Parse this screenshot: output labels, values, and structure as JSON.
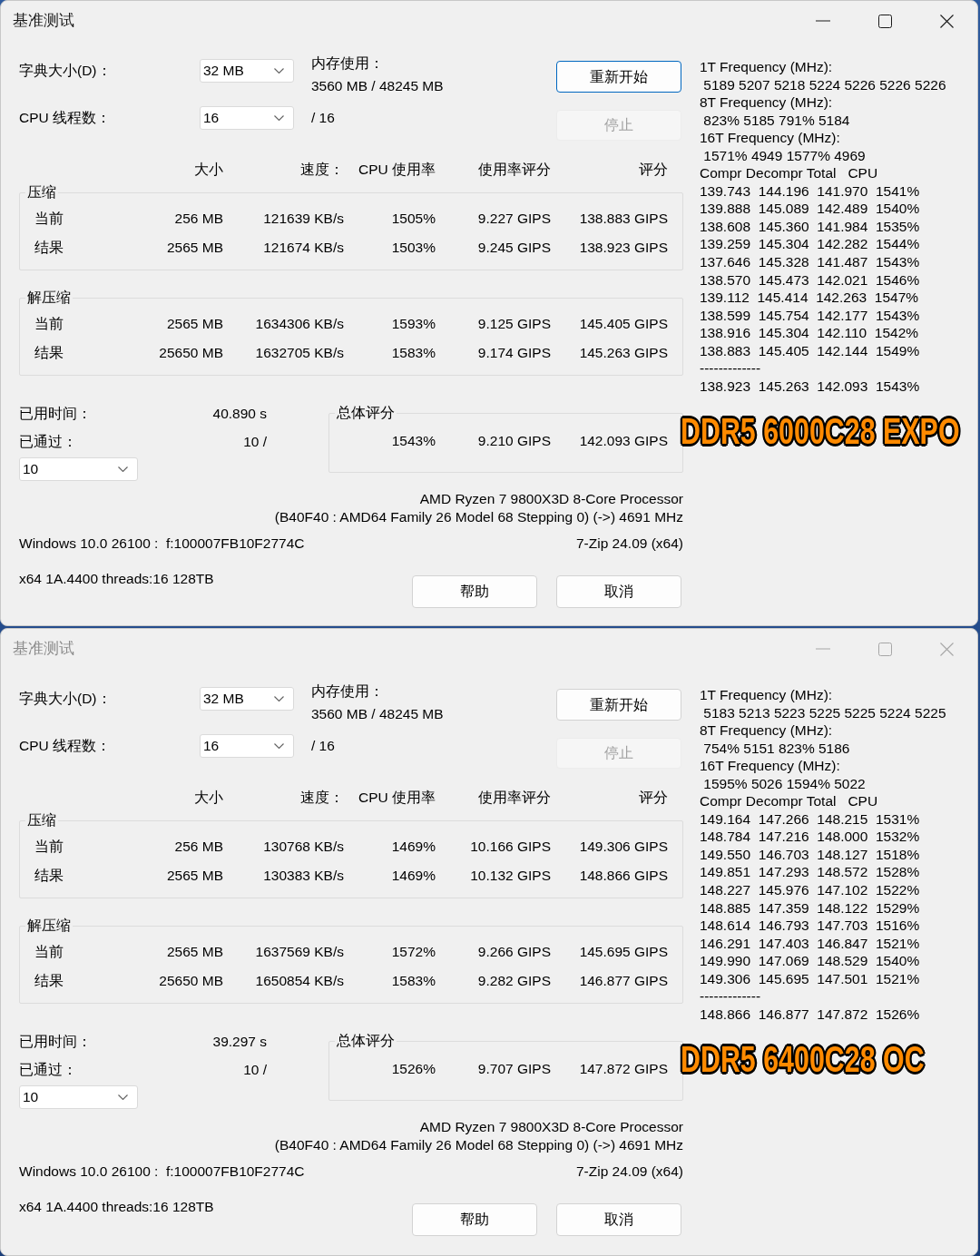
{
  "windows": [
    {
      "title": "基准测试",
      "active": true,
      "dictionary": {
        "label": "字典大小(D)：",
        "value": "32 MB"
      },
      "memory": {
        "label": "内存使用：",
        "value": "3560 MB / 48245 MB"
      },
      "threads": {
        "label": "CPU 线程数：",
        "value": "16",
        "total": "/ 16"
      },
      "action_buttons": [
        {
          "label": "重新开始",
          "focused": true,
          "disabled": false
        },
        {
          "label": "停止",
          "focused": false,
          "disabled": true
        }
      ],
      "columns": [
        "大小",
        "速度：",
        "CPU 使用率",
        "使用率评分",
        "评分"
      ],
      "groups": [
        {
          "title": "压缩",
          "rows": [
            {
              "label": "当前",
              "cells": [
                "256 MB",
                "121639 KB/s",
                "1505%",
                "9.227 GIPS",
                "138.883 GIPS"
              ]
            },
            {
              "label": "结果",
              "cells": [
                "2565 MB",
                "121674 KB/s",
                "1503%",
                "9.245 GIPS",
                "138.923 GIPS"
              ]
            }
          ]
        },
        {
          "title": "解压缩",
          "rows": [
            {
              "label": "当前",
              "cells": [
                "2565 MB",
                "1634306 KB/s",
                "1593%",
                "9.125 GIPS",
                "145.405 GIPS"
              ]
            },
            {
              "label": "结果",
              "cells": [
                "25650 MB",
                "1632705 KB/s",
                "1583%",
                "9.174 GIPS",
                "145.263 GIPS"
              ]
            }
          ]
        }
      ],
      "elapsed": {
        "label": "已用时间：",
        "value": "40.890 s"
      },
      "passes": {
        "label": "已通过：",
        "value": "10 /",
        "dropdown": "10"
      },
      "total": {
        "title": "总体评分",
        "cells": [
          "1543%",
          "9.210 GIPS",
          "142.093 GIPS"
        ]
      },
      "cpu_info": [
        "AMD Ryzen 7 9800X3D 8-Core Processor",
        "(B40F40 : AMD64 Family 26 Model 68 Stepping 0) (->) 4691 MHz"
      ],
      "system": "Windows 10.0 26100 :  f:100007FB10F2774C",
      "version": "7-Zip 24.09 (x64)",
      "build": "x64 1A.4400 threads:16 128TB",
      "footer_buttons": [
        "帮助",
        "取消"
      ],
      "log": [
        "1T Frequency (MHz):",
        " 5189 5207 5218 5224 5226 5226 5226",
        "8T Frequency (MHz):",
        " 823% 5185 791% 5184",
        "16T Frequency (MHz):",
        " 1571% 4949 1577% 4969",
        "Compr Decompr Total   CPU",
        "139.743  144.196  141.970  1541%",
        "139.888  145.089  142.489  1540%",
        "138.608  145.360  141.984  1535%",
        "139.259  145.304  142.282  1544%",
        "137.646  145.328  141.487  1543%",
        "138.570  145.473  142.021  1546%",
        "139.112  145.414  142.263  1547%",
        "138.599  145.754  142.177  1543%",
        "138.916  145.304  142.110  1542%",
        "138.883  145.405  142.144  1549%",
        "-------------",
        "138.923  145.263  142.093  1543%"
      ],
      "annotation": "DDR5 6000C28 EXPO"
    },
    {
      "title": "基准测试",
      "active": false,
      "dictionary": {
        "label": "字典大小(D)：",
        "value": "32 MB"
      },
      "memory": {
        "label": "内存使用：",
        "value": "3560 MB / 48245 MB"
      },
      "threads": {
        "label": "CPU 线程数：",
        "value": "16",
        "total": "/ 16"
      },
      "action_buttons": [
        {
          "label": "重新开始",
          "focused": false,
          "disabled": false
        },
        {
          "label": "停止",
          "focused": false,
          "disabled": true
        }
      ],
      "columns": [
        "大小",
        "速度：",
        "CPU 使用率",
        "使用率评分",
        "评分"
      ],
      "groups": [
        {
          "title": "压缩",
          "rows": [
            {
              "label": "当前",
              "cells": [
                "256 MB",
                "130768 KB/s",
                "1469%",
                "10.166 GIPS",
                "149.306 GIPS"
              ]
            },
            {
              "label": "结果",
              "cells": [
                "2565 MB",
                "130383 KB/s",
                "1469%",
                "10.132 GIPS",
                "148.866 GIPS"
              ]
            }
          ]
        },
        {
          "title": "解压缩",
          "rows": [
            {
              "label": "当前",
              "cells": [
                "2565 MB",
                "1637569 KB/s",
                "1572%",
                "9.266 GIPS",
                "145.695 GIPS"
              ]
            },
            {
              "label": "结果",
              "cells": [
                "25650 MB",
                "1650854 KB/s",
                "1583%",
                "9.282 GIPS",
                "146.877 GIPS"
              ]
            }
          ]
        }
      ],
      "elapsed": {
        "label": "已用时间：",
        "value": "39.297 s"
      },
      "passes": {
        "label": "已通过：",
        "value": "10 /",
        "dropdown": "10"
      },
      "total": {
        "title": "总体评分",
        "cells": [
          "1526%",
          "9.707 GIPS",
          "147.872 GIPS"
        ]
      },
      "cpu_info": [
        "AMD Ryzen 7 9800X3D 8-Core Processor",
        "(B40F40 : AMD64 Family 26 Model 68 Stepping 0) (->) 4691 MHz"
      ],
      "system": "Windows 10.0 26100 :  f:100007FB10F2774C",
      "version": "7-Zip 24.09 (x64)",
      "build": "x64 1A.4400 threads:16 128TB",
      "footer_buttons": [
        "帮助",
        "取消"
      ],
      "log": [
        "1T Frequency (MHz):",
        " 5183 5213 5223 5225 5225 5224 5225",
        "8T Frequency (MHz):",
        " 754% 5151 823% 5186",
        "16T Frequency (MHz):",
        " 1595% 5026 1594% 5022",
        "Compr Decompr Total   CPU",
        "149.164  147.266  148.215  1531%",
        "148.784  147.216  148.000  1532%",
        "149.550  146.703  148.127  1518%",
        "149.851  147.293  148.572  1528%",
        "148.227  145.976  147.102  1522%",
        "148.885  147.359  148.122  1529%",
        "148.614  146.793  147.703  1516%",
        "146.291  147.403  146.847  1521%",
        "149.990  147.069  148.529  1540%",
        "149.306  145.695  147.501  1521%",
        "-------------",
        "148.866  146.877  147.872  1526%"
      ],
      "annotation": "DDR5 6400C28 OC"
    }
  ]
}
